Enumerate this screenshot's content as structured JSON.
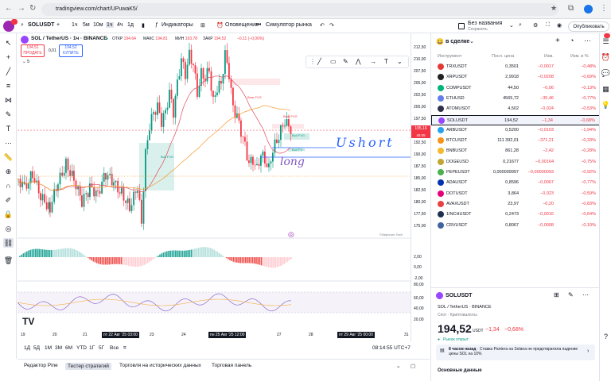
{
  "browser": {
    "url": "tradingview.com/chart/UPuwaK5/"
  },
  "toolbar": {
    "symbol": "SOLUSDT",
    "intervals": [
      "1ч",
      "5м",
      "10м",
      "1ч",
      "4ч",
      "1д"
    ],
    "indicators": "Индикаторы",
    "alerts": "Оповещения",
    "replay": "Симулятор рынка",
    "layout_name": "Без названия",
    "layout_sub": "Сохранить",
    "publish": "Опубликовать"
  },
  "chart": {
    "title": "SOL / TetherUS · 1ч · BINANCE",
    "open_label": "ОТКР",
    "open": "194,64",
    "high_label": "МАКС",
    "high": "194,81",
    "low_label": "МИН",
    "low": "193,78",
    "close_label": "ЗАКР",
    "close": "194,52",
    "change": "−0,11 (−0,06%)",
    "sell_price": "194,51",
    "sell_label": "ПРОДАТЬ",
    "spread": "0,01",
    "buy_price": "194,52",
    "buy_label": "КУПИТЬ",
    "indicator_count": "5",
    "annotation_short": "Ushort",
    "annotation_long": "long",
    "fvg_labels": [
      "Bear FVG",
      "Bear FVG",
      "Bull FVG",
      "Bull FVG",
      "Bull FVG"
    ],
    "watermark": "©Nephrum Tech",
    "current_price": "195,16",
    "current_time": "45:05"
  },
  "price_axis": [
    "212,50",
    "210,00",
    "207,50",
    "205,00",
    "202,50",
    "200,00",
    "197,50",
    "195,00",
    "192,50",
    "190,00",
    "187,50",
    "185,00",
    "182,50",
    "180,00",
    "177,50",
    "175,00"
  ],
  "osc_axis": [
    "2,00",
    "0,00",
    "-2,00"
  ],
  "rsi_axis": [
    "80,00",
    "60,00",
    "40,00",
    "20,00"
  ],
  "time_axis": {
    "labels": [
      "19",
      "20",
      "21",
      "23",
      "24",
      "26",
      "27",
      "28",
      "31"
    ],
    "hover1": "пт 22 Авг '25 03:00",
    "hover2": "пн 25 Авг '25 12:00",
    "hover3": "пт 29 Авг '25 00:00"
  },
  "ranges": [
    "1Д",
    "5Д",
    "1М",
    "3М",
    "6М",
    "YTD",
    "1Г",
    "5Г",
    "Все"
  ],
  "clock": "08:14:55 UTC+7",
  "bottom_tabs": [
    "Редактор Pine",
    "Тестер стратегий",
    "Торговля на исторических данных",
    "Торговая панель"
  ],
  "watchlist": {
    "title": "в сделке",
    "col_symbol": "Инструмент",
    "col_last": "Посл. цена",
    "col_change": "Изм.",
    "col_change_pct": "Изм. в %",
    "rows": [
      {
        "sym": "TRXUSDT",
        "last": "0,3501",
        "chg": "−0,0017",
        "pct": "−0,48%",
        "color": "#e53935"
      },
      {
        "sym": "XRPUSDT",
        "last": "2,9918",
        "chg": "−0,0208",
        "pct": "−0,69%",
        "color": "#222222"
      },
      {
        "sym": "COMPUSDT",
        "last": "44,50",
        "chg": "−0,06",
        "pct": "−0,13%",
        "color": "#00b57a"
      },
      {
        "sym": "ETHUSD",
        "last": "4565,72",
        "chg": "−35,46",
        "pct": "−0,77%",
        "color": "#627eea"
      },
      {
        "sym": "ATOMUSDT",
        "last": "4,502",
        "chg": "−0,024",
        "pct": "−0,53%",
        "color": "#2e3148"
      },
      {
        "sym": "SOLUSDT",
        "last": "194,52",
        "chg": "−1,34",
        "pct": "−0,68%",
        "color": "#9945ff"
      },
      {
        "sym": "ARBUSDT",
        "last": "0,5200",
        "chg": "−0,0103",
        "pct": "−1,94%",
        "color": "#28a0f0"
      },
      {
        "sym": "BTCUSDT",
        "last": "111 392,01",
        "chg": "−371,21",
        "pct": "−0,33%",
        "color": "#f7931a"
      },
      {
        "sym": "BNBUSDT",
        "last": "861,28",
        "chg": "−2,42",
        "pct": "−0,28%",
        "color": "#f3ba2f"
      },
      {
        "sym": "DOGEUSD",
        "last": "0,21677",
        "chg": "−0,00164",
        "pct": "−0,75%",
        "color": "#c2a633"
      },
      {
        "sym": "PEPEUSDT",
        "last": "0,000009997",
        "chg": "−0,00000093",
        "pct": "−0,92%",
        "color": "#4caf50"
      },
      {
        "sym": "ADAUSDT",
        "last": "0,8596",
        "chg": "−0,0067",
        "pct": "−0,77%",
        "color": "#0033ad"
      },
      {
        "sym": "DOTUSDT",
        "last": "3,864",
        "chg": "−0,023",
        "pct": "−0,59%",
        "color": "#e6007a"
      },
      {
        "sym": "AVAXUSDT",
        "last": "23,97",
        "chg": "−0,20",
        "pct": "−0,83%",
        "color": "#e84142"
      },
      {
        "sym": "1INCHUSDT",
        "last": "0,2473",
        "chg": "−0,0016",
        "pct": "−0,64%",
        "color": "#1b314f"
      },
      {
        "sym": "CRVUSDT",
        "last": "0,8067",
        "chg": "−0,0008",
        "pct": "−0,10%",
        "color": "#40649f"
      }
    ]
  },
  "details": {
    "symbol": "SOLUSDT",
    "name": "SOL / TetherUS",
    "exchange": "BINANCE",
    "type": "Спот · Криптовалюты",
    "price": "194,52",
    "currency": "USDT",
    "change": "−1,34",
    "change_pct": "−0,68%",
    "market_status": "Рынок открыт",
    "news_time": "8 часов назад",
    "news_text": "Ставка Pantera на Solana не предотвратила падение цены SOL на 10%",
    "section": "Основные данные"
  },
  "colors": {
    "red": "#f23645",
    "green": "#089981",
    "accent": "#2962ff"
  }
}
